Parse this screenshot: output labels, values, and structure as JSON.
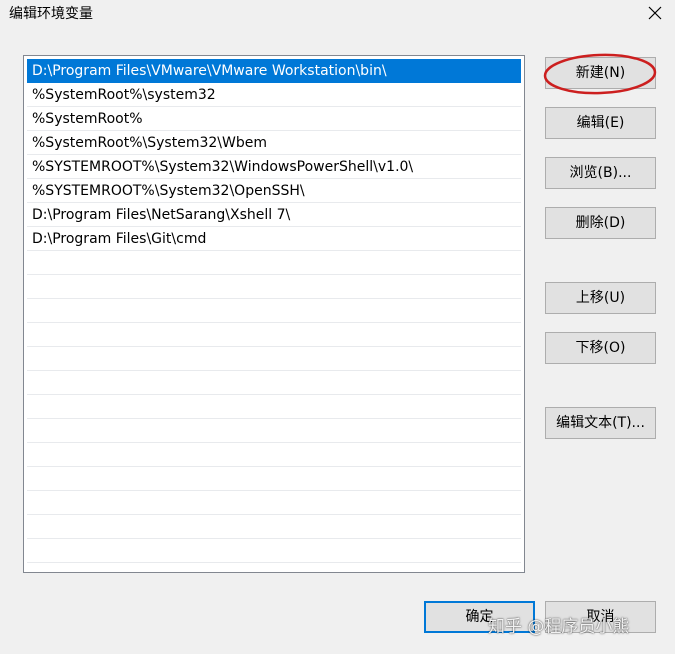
{
  "window": {
    "title": "编辑环境变量"
  },
  "path_list": {
    "items": [
      "D:\\Program Files\\VMware\\VMware Workstation\\bin\\",
      "%SystemRoot%\\system32",
      "%SystemRoot%",
      "%SystemRoot%\\System32\\Wbem",
      "%SYSTEMROOT%\\System32\\WindowsPowerShell\\v1.0\\",
      "%SYSTEMROOT%\\System32\\OpenSSH\\",
      "D:\\Program Files\\NetSarang\\Xshell 7\\",
      "D:\\Program Files\\Git\\cmd"
    ],
    "selected_index": 0
  },
  "buttons": {
    "new": "新建(N)",
    "edit": "编辑(E)",
    "browse": "浏览(B)...",
    "delete": "删除(D)",
    "move_up": "上移(U)",
    "move_down": "下移(O)",
    "edit_text": "编辑文本(T)...",
    "ok": "确定",
    "cancel": "取消"
  },
  "watermark": "知乎 @程序员小熊",
  "colors": {
    "selection": "#0078d7",
    "annotation_circle": "#cc1f1f",
    "window_bg": "#f0f0f0"
  },
  "icons": {
    "close": "close-icon"
  }
}
